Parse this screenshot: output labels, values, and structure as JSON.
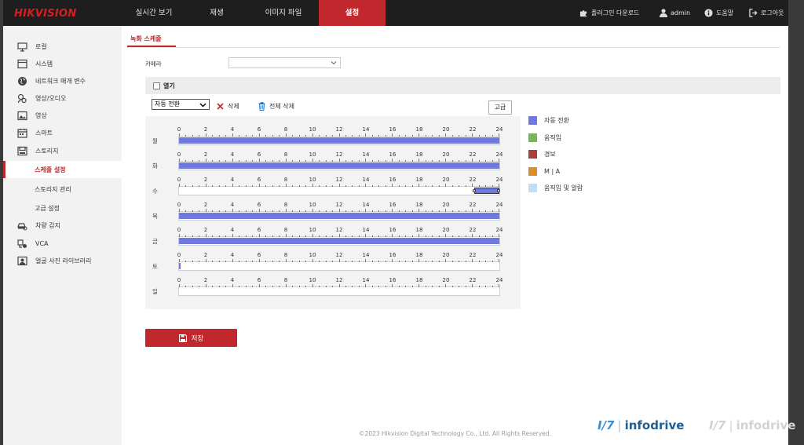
{
  "brand": {
    "logo_text": "HIKVISION",
    "accent_color": "#c0282d",
    "logo_color": "#d61e1e"
  },
  "nav": {
    "tabs": [
      {
        "label": "실시간 보기",
        "active": false
      },
      {
        "label": "재생",
        "active": false
      },
      {
        "label": "이미지 파일",
        "active": false
      },
      {
        "label": "설정",
        "active": true
      }
    ],
    "right": [
      {
        "icon": "puzzle-icon",
        "label": "플러그인 다운로드"
      },
      {
        "icon": "user-icon",
        "label": "admin"
      },
      {
        "icon": "help-icon",
        "label": "도움말"
      },
      {
        "icon": "logout-icon",
        "label": "로그아웃"
      }
    ]
  },
  "sidebar": {
    "items": [
      {
        "icon": "monitor-icon",
        "label": "로컬"
      },
      {
        "icon": "system-icon",
        "label": "시스템"
      },
      {
        "icon": "globe-icon",
        "label": "네트워크 매개 변수"
      },
      {
        "icon": "av-icon",
        "label": "영상/오디오"
      },
      {
        "icon": "image-icon",
        "label": "영상"
      },
      {
        "icon": "calendar-icon",
        "label": "스마트"
      },
      {
        "icon": "storage-icon",
        "label": "스토리지"
      },
      {
        "icon": "",
        "label": "스케줄 설정",
        "active": true
      },
      {
        "icon": "",
        "label": "스토리지 관리"
      },
      {
        "icon": "",
        "label": "고급 설정"
      },
      {
        "icon": "car-search-icon",
        "label": "차량 감지"
      },
      {
        "icon": "vca-icon",
        "label": "VCA"
      },
      {
        "icon": "photo-library-icon",
        "label": "얼굴 사진 라이브러리"
      }
    ]
  },
  "main": {
    "subtab": "녹화 스케줄",
    "camera_label": "카메라",
    "camera_value": "",
    "enable_label": "열기",
    "enable_checked": false,
    "mode_value": "자동 전환",
    "delete_label": "삭제",
    "delete_all_label": "전체 삭제",
    "advanced_label": "고급",
    "save_label": "저장",
    "schedule": {
      "ticks": [
        "0",
        "2",
        "4",
        "6",
        "8",
        "10",
        "12",
        "14",
        "16",
        "18",
        "20",
        "22",
        "24"
      ],
      "days": [
        {
          "label": "월",
          "segments": [
            [
              0,
              24
            ]
          ]
        },
        {
          "label": "화",
          "segments": [
            [
              0,
              24
            ]
          ]
        },
        {
          "label": "수",
          "segments": [
            [
              22.1,
              24
            ]
          ],
          "selected": true
        },
        {
          "label": "목",
          "segments": [
            [
              0,
              24
            ]
          ]
        },
        {
          "label": "금",
          "segments": [
            [
              0,
              24
            ]
          ]
        },
        {
          "label": "토",
          "segments": [
            [
              0,
              0.1
            ]
          ]
        },
        {
          "label": "일",
          "segments": []
        }
      ]
    },
    "legend": [
      {
        "label": "자동 전환",
        "color": "#7079de"
      },
      {
        "label": "움직임",
        "color": "#7ab35a"
      },
      {
        "label": "경보",
        "color": "#a8413b"
      },
      {
        "label": "M | A",
        "color": "#d98d2b"
      },
      {
        "label": "움직임 및 알람",
        "color": "#c5dcf5"
      }
    ]
  },
  "footer": {
    "copyright": "©2023 Hikvision Digital Technology Co., Ltd. All Rights Reserved."
  },
  "watermark": {
    "mark": "I/7",
    "text": "infodrive"
  }
}
